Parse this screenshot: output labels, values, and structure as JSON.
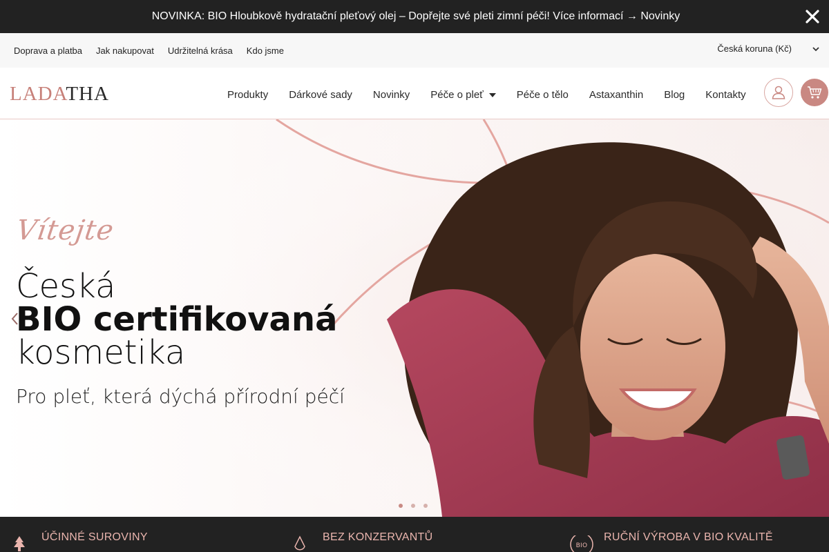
{
  "announcement": {
    "icon_glyph": "",
    "text": "NOVINKA: BIO Hloubkově hydratační pleťový olej – Dopřejte své pleti zimní péči! Více informací → Novinky",
    "close_icon": "close-icon"
  },
  "utility_bar": {
    "links": [
      "Doprava a platba",
      "Jak nakupovat",
      "Udržitelná krása",
      "Kdo jsme"
    ],
    "currency": "Česká koruna (Kč)",
    "currency_chevron": "⌄"
  },
  "header": {
    "logo_part1": "LADA",
    "logo_part2": "THA",
    "nav": [
      "Produkty",
      "Dárkové sady",
      "Novinky",
      "Péče o pleť",
      "Péče o tělo",
      "Astaxanthin",
      "Blog",
      "Kontakty"
    ],
    "account_icon": "user-icon",
    "cart_icon": "cart-icon"
  },
  "hero": {
    "welcome": "Vítejte",
    "line1": "Česká",
    "line2": "BIO certifikovaná",
    "line3": "kosmetika",
    "subtitle": "Pro pleť, která dýchá přírodní péčí",
    "slide_count": 3,
    "active_slide": 1
  },
  "features": [
    {
      "label": "ÚČINNÉ SUROVINY",
      "icon": "pine-tree-icon"
    },
    {
      "label": "BEZ KONZERVANTŮ",
      "icon": "drop-icon"
    },
    {
      "label": "RUČNÍ VÝROBA V BIO KVALITĚ",
      "icon": "bio-badge-icon"
    }
  ],
  "colors": {
    "accent": "#c98882",
    "dark": "#222222",
    "feature_text": "#eab5ae"
  }
}
